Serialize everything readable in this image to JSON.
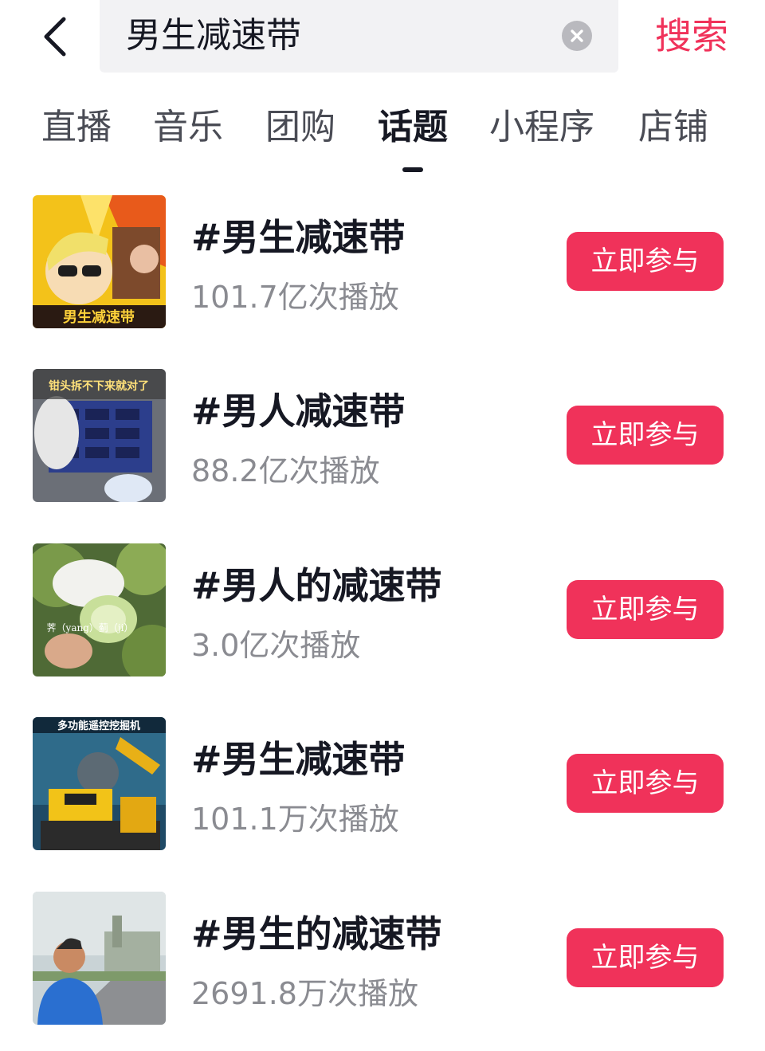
{
  "search": {
    "query": "男生减速带",
    "submit_label": "搜索"
  },
  "tabs": [
    {
      "label": "直播",
      "active": false
    },
    {
      "label": "音乐",
      "active": false
    },
    {
      "label": "团购",
      "active": false
    },
    {
      "label": "话题",
      "active": true
    },
    {
      "label": "小程序",
      "active": false
    },
    {
      "label": "店铺",
      "active": false
    }
  ],
  "topics": [
    {
      "title": "#男生减速带",
      "count": "101.7亿次播放",
      "button": "立即参与",
      "thumb_caption": "男生减速带"
    },
    {
      "title": "#男人减速带",
      "count": "88.2亿次播放",
      "button": "立即参与",
      "thumb_caption": "钳头拆不下来就对了"
    },
    {
      "title": "#男人的减速带",
      "count": "3.0亿次播放",
      "button": "立即参与",
      "thumb_caption": "荠（yang）蓟（ji）"
    },
    {
      "title": "#男生减速带",
      "count": "101.1万次播放",
      "button": "立即参与",
      "thumb_caption": "多功能遥控挖掘机"
    },
    {
      "title": "#男生的减速带",
      "count": "2691.8万次播放",
      "button": "立即参与",
      "thumb_caption": ""
    }
  ],
  "colors": {
    "accent": "#f0325a",
    "text_primary": "#161823",
    "text_secondary": "#8a8b91",
    "search_bg": "#f2f2f4"
  },
  "icons": {
    "back": "chevron-left-icon",
    "clear": "close-circle-icon"
  }
}
